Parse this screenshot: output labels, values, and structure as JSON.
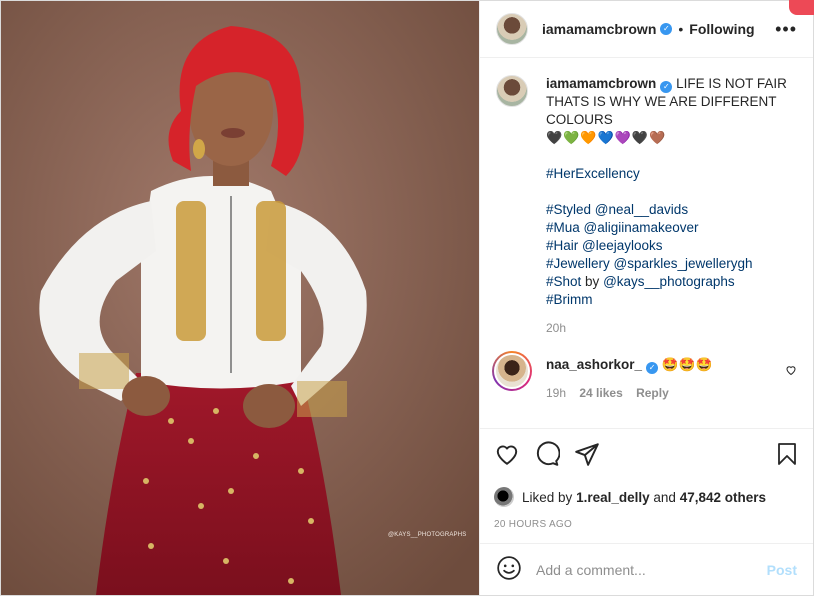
{
  "header": {
    "username": "iamamamcbrown",
    "separator": "•",
    "follow_status": "Following",
    "more_icon": "ellipsis-icon"
  },
  "photo": {
    "watermark": "@KAYS__PHOTOGRAPHS"
  },
  "caption": {
    "username": "iamamamcbrown",
    "text_line1": "LIFE IS NOT FAIR",
    "text_line2": "THATS IS WHY WE ARE DIFFERENT",
    "text_line3": "COLOURS",
    "hearts": "🖤💚🧡💙💜🖤🤎",
    "hashtag": "#HerExcellency",
    "styled_tag": "#Styled",
    "styled_mention": "@neal__davids",
    "mua_tag": "#Mua",
    "mua_mention": "@aligiinamakeover",
    "hair_tag": "#Hair",
    "hair_mention": "@leejaylooks",
    "jewellery_tag": "#Jewellery",
    "jewellery_mention": "@sparkles_jewellerygh",
    "shot_tag": "#Shot",
    "shot_by": "by",
    "shot_mention": "@kays__photographs",
    "brimm_tag": "#Brimm",
    "time": "20h"
  },
  "comment": {
    "username": "naa_ashorkor_",
    "text": "🤩🤩🤩",
    "time": "19h",
    "likes": "24 likes",
    "reply": "Reply"
  },
  "likes": {
    "prefix": "Liked by",
    "user": "1.real_delly",
    "and": "and",
    "others": "47,842 others"
  },
  "post_age": "20 HOURS AGO",
  "add_comment": {
    "placeholder": "Add a comment...",
    "post_label": "Post"
  },
  "colors": {
    "text": "#262626",
    "muted": "#8e8e8e",
    "link": "#00376b",
    "post_disabled": "#b2dffc",
    "verified": "#3897f0"
  }
}
